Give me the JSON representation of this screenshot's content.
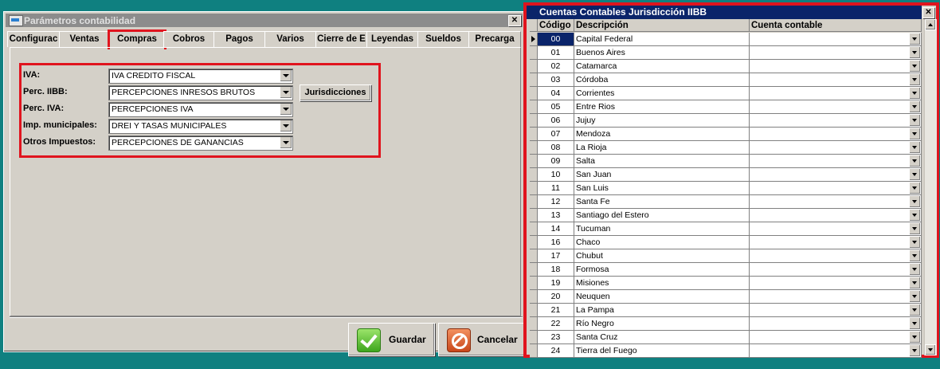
{
  "dialog": {
    "title": "Parámetros contabilidad",
    "close_label": "✕",
    "tabs": [
      {
        "label": "Configurac",
        "active": false
      },
      {
        "label": "Ventas",
        "active": false
      },
      {
        "label": "Compras",
        "active": true
      },
      {
        "label": "Cobros",
        "active": false
      },
      {
        "label": "Pagos",
        "active": false
      },
      {
        "label": "Varios",
        "active": false
      },
      {
        "label": "Cierre de E",
        "active": false
      },
      {
        "label": "Leyendas",
        "active": false
      },
      {
        "label": "Sueldos",
        "active": false
      },
      {
        "label": "Precarga",
        "active": false
      }
    ],
    "fields": [
      {
        "label": "IVA:",
        "value": "IVA CREDITO FISCAL"
      },
      {
        "label": "Perc. IIBB:",
        "value": "PERCEPCIONES INRESOS BRUTOS"
      },
      {
        "label": "Perc. IVA:",
        "value": "PERCEPCIONES IVA"
      },
      {
        "label": "Imp. municipales:",
        "value": "DREI Y TASAS MUNICIPALES"
      },
      {
        "label": "Otros Impuestos:",
        "value": "PERCEPCIONES DE GANANCIAS"
      }
    ],
    "jurisdicciones_label": "Jurisdicciones",
    "guardar_label": "Guardar",
    "cancelar_label": "Cancelar"
  },
  "grid_window": {
    "title": "Cuentas Contables Jurisdicción IIBB",
    "close_label": "✕",
    "columns": {
      "codigo": "Código",
      "descripcion": "Descripción",
      "cuenta": "Cuenta contable"
    },
    "rows": [
      {
        "codigo": "00",
        "descripcion": "Capital Federal",
        "cuenta": ""
      },
      {
        "codigo": "01",
        "descripcion": "Buenos Aires",
        "cuenta": ""
      },
      {
        "codigo": "02",
        "descripcion": "Catamarca",
        "cuenta": ""
      },
      {
        "codigo": "03",
        "descripcion": "Córdoba",
        "cuenta": ""
      },
      {
        "codigo": "04",
        "descripcion": "Corrientes",
        "cuenta": ""
      },
      {
        "codigo": "05",
        "descripcion": "Entre Rios",
        "cuenta": ""
      },
      {
        "codigo": "06",
        "descripcion": "Jujuy",
        "cuenta": ""
      },
      {
        "codigo": "07",
        "descripcion": "Mendoza",
        "cuenta": ""
      },
      {
        "codigo": "08",
        "descripcion": "La Rioja",
        "cuenta": ""
      },
      {
        "codigo": "09",
        "descripcion": "Salta",
        "cuenta": ""
      },
      {
        "codigo": "10",
        "descripcion": "San Juan",
        "cuenta": ""
      },
      {
        "codigo": "11",
        "descripcion": "San Luis",
        "cuenta": ""
      },
      {
        "codigo": "12",
        "descripcion": "Santa Fe",
        "cuenta": ""
      },
      {
        "codigo": "13",
        "descripcion": "Santiago del Estero",
        "cuenta": ""
      },
      {
        "codigo": "14",
        "descripcion": "Tucuman",
        "cuenta": ""
      },
      {
        "codigo": "16",
        "descripcion": "Chaco",
        "cuenta": ""
      },
      {
        "codigo": "17",
        "descripcion": "Chubut",
        "cuenta": ""
      },
      {
        "codigo": "18",
        "descripcion": "Formosa",
        "cuenta": ""
      },
      {
        "codigo": "19",
        "descripcion": "Misiones",
        "cuenta": ""
      },
      {
        "codigo": "20",
        "descripcion": "Neuquen",
        "cuenta": ""
      },
      {
        "codigo": "21",
        "descripcion": "La Pampa",
        "cuenta": ""
      },
      {
        "codigo": "22",
        "descripcion": "Río Negro",
        "cuenta": ""
      },
      {
        "codigo": "23",
        "descripcion": "Santa Cruz",
        "cuenta": ""
      },
      {
        "codigo": "24",
        "descripcion": "Tierra del Fuego",
        "cuenta": ""
      }
    ]
  },
  "colors": {
    "desktop": "#0f8080",
    "highlight_border": "#e0141e",
    "active_title": "#0a246a",
    "inactive_title": "#8c8c8c"
  }
}
